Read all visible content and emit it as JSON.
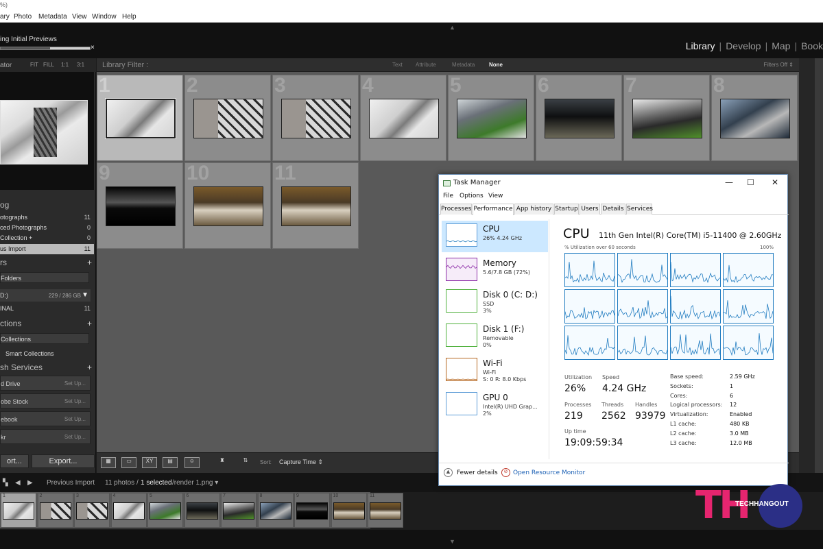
{
  "menubar": {
    "title_fragment": "%)",
    "items": [
      "ary",
      "Photo",
      "Metadata",
      "View",
      "Window",
      "Help"
    ]
  },
  "progress": {
    "label": "ing Initial Previews",
    "fraction": 0.55,
    "close": "×"
  },
  "modules": [
    "Library",
    "Develop",
    "Map",
    "Book"
  ],
  "navigator": {
    "title": "ator",
    "zoom": [
      "FIT",
      "FILL",
      "1:1",
      "3:1"
    ]
  },
  "catalog": {
    "header": "og",
    "rows": [
      {
        "label": "otographs",
        "count": "11"
      },
      {
        "label": "ced Photographs",
        "count": "0"
      },
      {
        "label": " Collection  +",
        "count": "0"
      },
      {
        "label": "us Import",
        "count": "11"
      }
    ]
  },
  "folders": {
    "header": "rs",
    "filter": " Folders",
    "drive": {
      "label": "D:)",
      "size": "229 / 286 GB"
    },
    "folder": {
      "label": "INAL",
      "count": "11"
    }
  },
  "collections": {
    "header": "ctions",
    "filter": " Collections",
    "smart": "Smart Collections"
  },
  "publish": {
    "header": "sh Services",
    "items": [
      {
        "label": "d Drive",
        "action": "Set Up..."
      },
      {
        "label": "obe Stock",
        "action": "Set Up..."
      },
      {
        "label": "ebook",
        "action": "Set Up..."
      },
      {
        "label": "kr",
        "action": "Set Up..."
      }
    ]
  },
  "left_buttons": {
    "import": "ort...",
    "export": "Export..."
  },
  "filter_bar": {
    "label": "Library Filter :",
    "options": [
      "Text",
      "Attribute",
      "Metadata",
      "None"
    ],
    "active": "None",
    "filters_off": "Filters Off ⇕"
  },
  "grid": {
    "numbers": [
      "1",
      "2",
      "3",
      "4",
      "5",
      "6",
      "7",
      "8",
      "9",
      "10",
      "11"
    ]
  },
  "toolbar": {
    "sort_label": "Sort:",
    "sort_value": "Capture Time  ⇕",
    "drop": "▾"
  },
  "status": {
    "source": "Previous Import",
    "count": "11 photos /",
    "selected": "1 selected",
    "file": "/render 1.png ▾"
  },
  "filmstrip": {
    "numbers": [
      "1",
      "2",
      "3",
      "4",
      "5",
      "6",
      "7",
      "8",
      "9",
      "10",
      "11"
    ]
  },
  "task_manager": {
    "title": "Task Manager",
    "controls": [
      "—",
      "☐",
      "✕"
    ],
    "menu": [
      "File",
      "Options",
      "View"
    ],
    "tabs": [
      "Processes",
      "Performance",
      "App history",
      "Startup",
      "Users",
      "Details",
      "Services"
    ],
    "active_tab": "Performance",
    "side": [
      {
        "title": "CPU",
        "sub1": "26%  4.24 GHz",
        "sub2": "",
        "color": "#1f7bc0"
      },
      {
        "title": "Memory",
        "sub1": "5.6/7.8 GB (72%)",
        "sub2": "",
        "color": "#8b2aa6"
      },
      {
        "title": "Disk 0 (C: D:)",
        "sub1": "SSD",
        "sub2": "3%",
        "color": "#4caf38"
      },
      {
        "title": "Disk 1 (F:)",
        "sub1": "Removable",
        "sub2": "0%",
        "color": "#4caf38"
      },
      {
        "title": "Wi-Fi",
        "sub1": "Wi-Fi",
        "sub2": "S: 0  R: 8.0 Kbps",
        "color": "#b5651d"
      },
      {
        "title": "GPU 0",
        "sub1": "Intel(R) UHD Grap...",
        "sub2": "2%",
        "color": "#1f7bc0"
      }
    ],
    "main": {
      "title": "CPU",
      "model": "11th Gen Intel(R) Core(TM) i5-11400 @ 2.60GHz",
      "graph_label": "% Utilization over 60 seconds",
      "graph_max": "100%"
    },
    "stats": {
      "utilization": {
        "label": "Utilization",
        "value": "26%"
      },
      "speed": {
        "label": "Speed",
        "value": "4.24 GHz"
      },
      "processes": {
        "label": "Processes",
        "value": "219"
      },
      "threads": {
        "label": "Threads",
        "value": "2562"
      },
      "handles": {
        "label": "Handles",
        "value": "93979"
      },
      "uptime": {
        "label": "Up time",
        "value": "19:09:59:34"
      }
    },
    "specs": [
      {
        "k": "Base speed:",
        "v": "2.59 GHz"
      },
      {
        "k": "Sockets:",
        "v": "1"
      },
      {
        "k": "Cores:",
        "v": "6"
      },
      {
        "k": "Logical processors:",
        "v": "12"
      },
      {
        "k": "Virtualization:",
        "v": "Enabled"
      },
      {
        "k": "L1 cache:",
        "v": "480 KB"
      },
      {
        "k": "L2 cache:",
        "v": "3.0 MB"
      },
      {
        "k": "L3 cache:",
        "v": "12.0 MB"
      }
    ],
    "footer": {
      "fewer": "Fewer details",
      "monitor": "Open Resource Monitor"
    }
  },
  "watermark": {
    "logo_letters": "TH",
    "text": "TECHHANGOUT",
    "colors": {
      "pink": "#e6256f",
      "navy": "#2b2f86"
    }
  }
}
